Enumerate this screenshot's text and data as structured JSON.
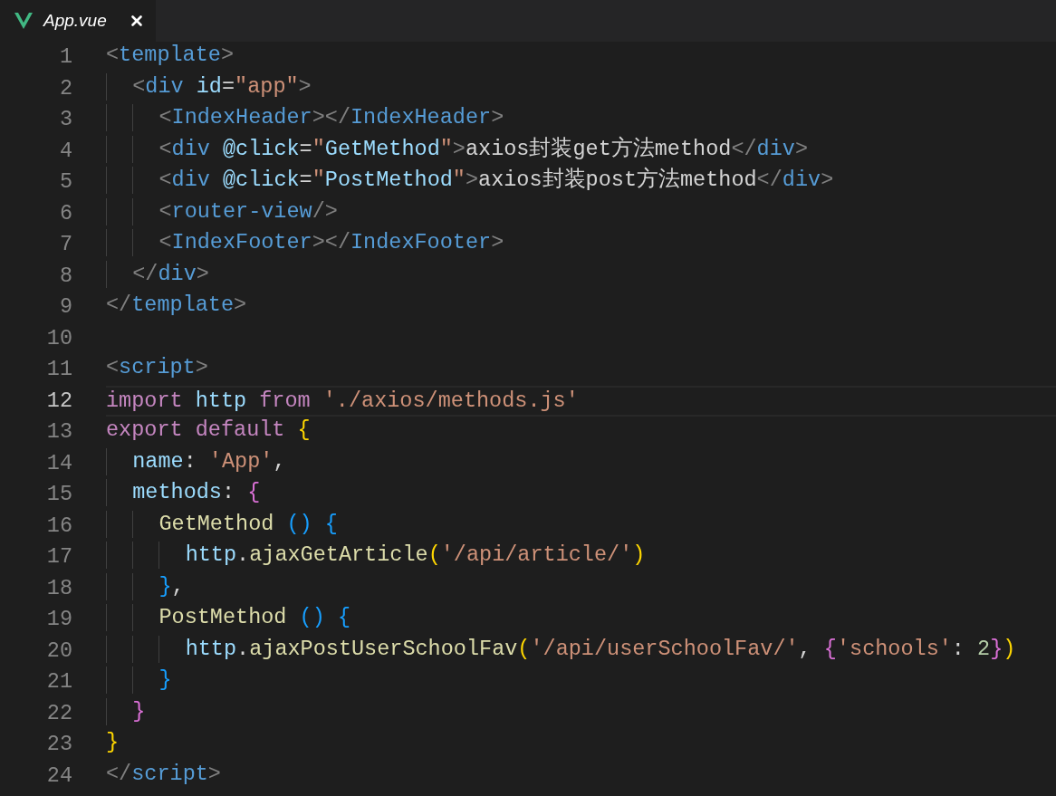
{
  "tab": {
    "label": "App.vue",
    "preview": true,
    "selected": true
  },
  "lines": [
    {
      "number": "1",
      "current": false,
      "tokens": [
        {
          "text": "<",
          "kind": "punct"
        },
        {
          "text": "template",
          "kind": "tag"
        },
        {
          "text": ">",
          "kind": "punct"
        }
      ]
    },
    {
      "number": "2",
      "current": false,
      "tokens": [
        {
          "text": "  <",
          "kind": "punct"
        },
        {
          "text": "div ",
          "kind": "tag"
        },
        {
          "text": "id",
          "kind": "attr"
        },
        {
          "text": "=",
          "kind": "plain"
        },
        {
          "text": "\"app\"",
          "kind": "str"
        },
        {
          "text": ">",
          "kind": "punct"
        }
      ]
    },
    {
      "number": "3",
      "current": false,
      "tokens": [
        {
          "text": "    <",
          "kind": "punct"
        },
        {
          "text": "IndexHeader",
          "kind": "tag"
        },
        {
          "text": "></",
          "kind": "punct"
        },
        {
          "text": "IndexHeader",
          "kind": "tag"
        },
        {
          "text": ">",
          "kind": "punct"
        }
      ]
    },
    {
      "number": "4",
      "current": false,
      "tokens": [
        {
          "text": "    <",
          "kind": "punct"
        },
        {
          "text": "div ",
          "kind": "tag"
        },
        {
          "text": "@click",
          "kind": "attr"
        },
        {
          "text": "=",
          "kind": "plain"
        },
        {
          "text": "\"",
          "kind": "str"
        },
        {
          "text": "GetMethod",
          "kind": "var"
        },
        {
          "text": "\"",
          "kind": "str"
        },
        {
          "text": ">",
          "kind": "punct"
        },
        {
          "text": "axios封装get方法method",
          "kind": "plain"
        },
        {
          "text": "</",
          "kind": "punct"
        },
        {
          "text": "div",
          "kind": "tag"
        },
        {
          "text": ">",
          "kind": "punct"
        }
      ]
    },
    {
      "number": "5",
      "current": false,
      "tokens": [
        {
          "text": "    <",
          "kind": "punct"
        },
        {
          "text": "div ",
          "kind": "tag"
        },
        {
          "text": "@click",
          "kind": "attr"
        },
        {
          "text": "=",
          "kind": "plain"
        },
        {
          "text": "\"",
          "kind": "str"
        },
        {
          "text": "PostMethod",
          "kind": "var"
        },
        {
          "text": "\"",
          "kind": "str"
        },
        {
          "text": ">",
          "kind": "punct"
        },
        {
          "text": "axios封装post方法method",
          "kind": "plain"
        },
        {
          "text": "</",
          "kind": "punct"
        },
        {
          "text": "div",
          "kind": "tag"
        },
        {
          "text": ">",
          "kind": "punct"
        }
      ]
    },
    {
      "number": "6",
      "current": false,
      "tokens": [
        {
          "text": "    <",
          "kind": "punct"
        },
        {
          "text": "router-view",
          "kind": "tag"
        },
        {
          "text": "/>",
          "kind": "punct"
        }
      ]
    },
    {
      "number": "7",
      "current": false,
      "tokens": [
        {
          "text": "    <",
          "kind": "punct"
        },
        {
          "text": "IndexFooter",
          "kind": "tag"
        },
        {
          "text": "></",
          "kind": "punct"
        },
        {
          "text": "IndexFooter",
          "kind": "tag"
        },
        {
          "text": ">",
          "kind": "punct"
        }
      ]
    },
    {
      "number": "8",
      "current": false,
      "tokens": [
        {
          "text": "  </",
          "kind": "punct"
        },
        {
          "text": "div",
          "kind": "tag"
        },
        {
          "text": ">",
          "kind": "punct"
        }
      ]
    },
    {
      "number": "9",
      "current": false,
      "tokens": [
        {
          "text": "</",
          "kind": "punct"
        },
        {
          "text": "template",
          "kind": "tag"
        },
        {
          "text": ">",
          "kind": "punct"
        }
      ]
    },
    {
      "number": "10",
      "current": false
    },
    {
      "number": "11",
      "current": false,
      "tokens": [
        {
          "text": "<",
          "kind": "punct"
        },
        {
          "text": "script",
          "kind": "tag"
        },
        {
          "text": ">",
          "kind": "punct"
        }
      ]
    },
    {
      "number": "12",
      "current": true,
      "tokens": [
        {
          "text": "import ",
          "kind": "kw"
        },
        {
          "text": "http ",
          "kind": "var"
        },
        {
          "text": "from ",
          "kind": "kw"
        },
        {
          "text": "'./axios/methods.js'",
          "kind": "str"
        }
      ]
    },
    {
      "number": "13",
      "current": false,
      "tokens": [
        {
          "text": "export default ",
          "kind": "kw"
        },
        {
          "text": "{",
          "kind": "b1"
        }
      ]
    },
    {
      "number": "14",
      "current": false,
      "tokens": [
        {
          "text": "  name",
          "kind": "var"
        },
        {
          "text": ": ",
          "kind": "plain"
        },
        {
          "text": "'App'",
          "kind": "str"
        },
        {
          "text": ",",
          "kind": "plain"
        }
      ]
    },
    {
      "number": "15",
      "current": false,
      "tokens": [
        {
          "text": "  methods",
          "kind": "var"
        },
        {
          "text": ": ",
          "kind": "plain"
        },
        {
          "text": "{",
          "kind": "b2"
        }
      ]
    },
    {
      "number": "16",
      "current": false,
      "tokens": [
        {
          "text": "    GetMethod ",
          "kind": "fn"
        },
        {
          "text": "() {",
          "kind": "b3"
        }
      ]
    },
    {
      "number": "17",
      "current": false,
      "tokens": [
        {
          "text": "      http",
          "kind": "var"
        },
        {
          "text": ".",
          "kind": "plain"
        },
        {
          "text": "ajaxGetArticle",
          "kind": "fn"
        },
        {
          "text": "(",
          "kind": "b1"
        },
        {
          "text": "'/api/article/'",
          "kind": "str"
        },
        {
          "text": ")",
          "kind": "b1"
        }
      ]
    },
    {
      "number": "18",
      "current": false,
      "tokens": [
        {
          "text": "    }",
          "kind": "b3"
        },
        {
          "text": ",",
          "kind": "plain"
        }
      ]
    },
    {
      "number": "19",
      "current": false,
      "tokens": [
        {
          "text": "    PostMethod ",
          "kind": "fn"
        },
        {
          "text": "() {",
          "kind": "b3"
        }
      ]
    },
    {
      "number": "20",
      "current": false,
      "tokens": [
        {
          "text": "      http",
          "kind": "var"
        },
        {
          "text": ".",
          "kind": "plain"
        },
        {
          "text": "ajaxPostUserSchoolFav",
          "kind": "fn"
        },
        {
          "text": "(",
          "kind": "b1"
        },
        {
          "text": "'/api/userSchoolFav/'",
          "kind": "str"
        },
        {
          "text": ", ",
          "kind": "plain"
        },
        {
          "text": "{",
          "kind": "b2"
        },
        {
          "text": "'schools'",
          "kind": "str"
        },
        {
          "text": ": ",
          "kind": "plain"
        },
        {
          "text": "2",
          "kind": "num"
        },
        {
          "text": "}",
          "kind": "b2"
        },
        {
          "text": ")",
          "kind": "b1"
        }
      ]
    },
    {
      "number": "21",
      "current": false,
      "tokens": [
        {
          "text": "    }",
          "kind": "b3"
        }
      ]
    },
    {
      "number": "22",
      "current": false,
      "tokens": [
        {
          "text": "  }",
          "kind": "b2"
        }
      ]
    },
    {
      "number": "23",
      "current": false,
      "tokens": [
        {
          "text": "}",
          "kind": "b1"
        }
      ]
    },
    {
      "number": "24",
      "current": false,
      "tokens": [
        {
          "text": "</",
          "kind": "punct"
        },
        {
          "text": "script",
          "kind": "tag"
        },
        {
          "text": ">",
          "kind": "punct"
        }
      ]
    }
  ]
}
